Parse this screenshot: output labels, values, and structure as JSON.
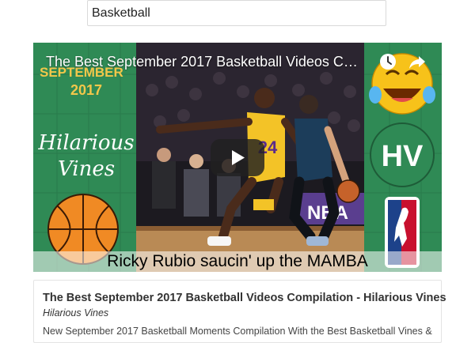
{
  "search": {
    "value": "Basketball"
  },
  "video": {
    "title": "The Best September 2017 Basketball Videos Com...",
    "left_panel": {
      "month": "SEPTEMBER",
      "year": "2017",
      "line1": "Hilarious",
      "line2": "Vines"
    },
    "caption": "Ricky Rubio saucin' up the MAMBA",
    "jersey_number": "24",
    "banner_text": "NBA",
    "logo_text": "HV",
    "controls": {
      "watch_later_icon": "clock-icon",
      "share_icon": "share-arrow-icon",
      "play_icon": "play-icon"
    }
  },
  "result": {
    "title": "The Best September 2017 Basketball Videos Compilation - Hilarious Vines",
    "channel": "Hilarious Vines",
    "description": "New September 2017 Basketball Moments Compilation With the Best Basketball Vines &"
  },
  "colors": {
    "panel_green": "#2f7a4a",
    "gold_text": "#f2c74a",
    "play_button_bg": "#212121"
  }
}
